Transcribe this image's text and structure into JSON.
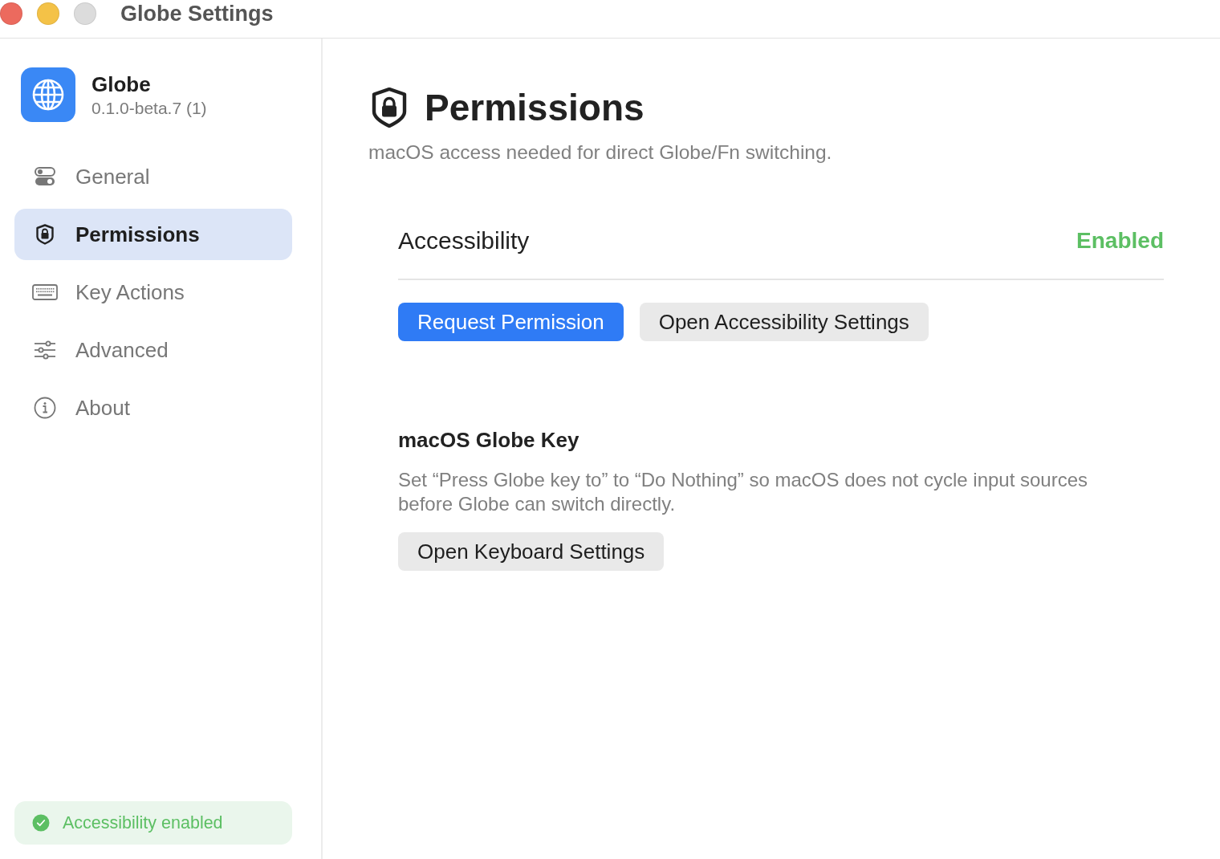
{
  "window": {
    "title": "Globe Settings",
    "controls": [
      {
        "kind": "close",
        "disabled": false
      },
      {
        "kind": "minimize",
        "disabled": false
      },
      {
        "kind": "zoom",
        "disabled": true
      }
    ]
  },
  "sidebar": {
    "app": {
      "name": "Globe",
      "version": "0.1.0-beta.7 (1)"
    },
    "items": [
      {
        "label": "General",
        "selected": false
      },
      {
        "label": "Permissions",
        "selected": true
      },
      {
        "label": "Key Actions",
        "selected": false
      },
      {
        "label": "Advanced",
        "selected": false
      },
      {
        "label": "About",
        "selected": false
      }
    ],
    "status": {
      "text": "Accessibility enabled",
      "on": true
    }
  },
  "main": {
    "header": {
      "title": "Permissions",
      "subtitle": "macOS access needed for direct Globe/Fn switching."
    },
    "permission": {
      "label": "Accessibility",
      "status": "Enabled",
      "on": true,
      "buttons": [
        {
          "label": "Request Permission",
          "kind": "primary"
        },
        {
          "label": "Open Accessibility Settings",
          "kind": "secondary"
        }
      ]
    },
    "section": {
      "title": "macOS Globe Key",
      "description": "Set “Press Globe key to” to “Do Nothing” so macOS does not cycle input sources before Globe can switch directly.",
      "buttons": [
        {
          "label": "Open Keyboard Settings",
          "kind": "secondary"
        }
      ]
    }
  }
}
